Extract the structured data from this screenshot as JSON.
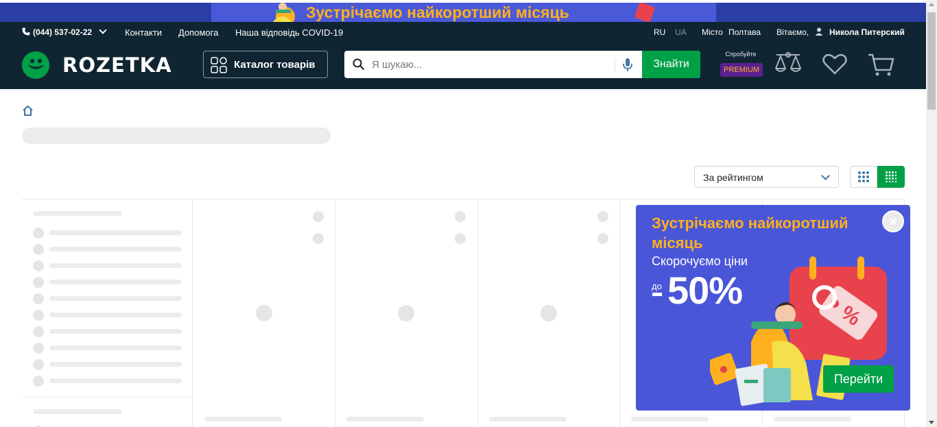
{
  "promo_strip": {
    "text": "Зустрічаємо найкоротший місяць"
  },
  "header": {
    "phone": "(044) 537-02-22",
    "links": [
      "Контакти",
      "Допомога",
      "Наша відповідь COVID-19"
    ],
    "lang_ru": "RU",
    "lang_ua": "UA",
    "city_label": "Місто",
    "city_value": "Полтава",
    "greeting": "Вітаємо,",
    "user_name": "Никола Питерский",
    "logo_text": "ROZETKA",
    "catalog_label": "Каталог товарів",
    "search_placeholder": "Я шукаю...",
    "search_button": "Знайти",
    "premium_try": "Спробуйте",
    "premium_badge": "PREMIUM"
  },
  "toolbar": {
    "sort_value": "За рейтингом"
  },
  "popup": {
    "title": "Зустрічаємо найкоротший місяць",
    "subtitle": "Скорочуємо ціни",
    "upto": "до",
    "discount": "50%",
    "button": "Перейти"
  },
  "colors": {
    "header_bg": "#0f2532",
    "brand_green": "#00a046",
    "promo_blue": "#4a56d8",
    "promo_orange": "#ffb01f",
    "premium_purple": "#5b2190"
  }
}
